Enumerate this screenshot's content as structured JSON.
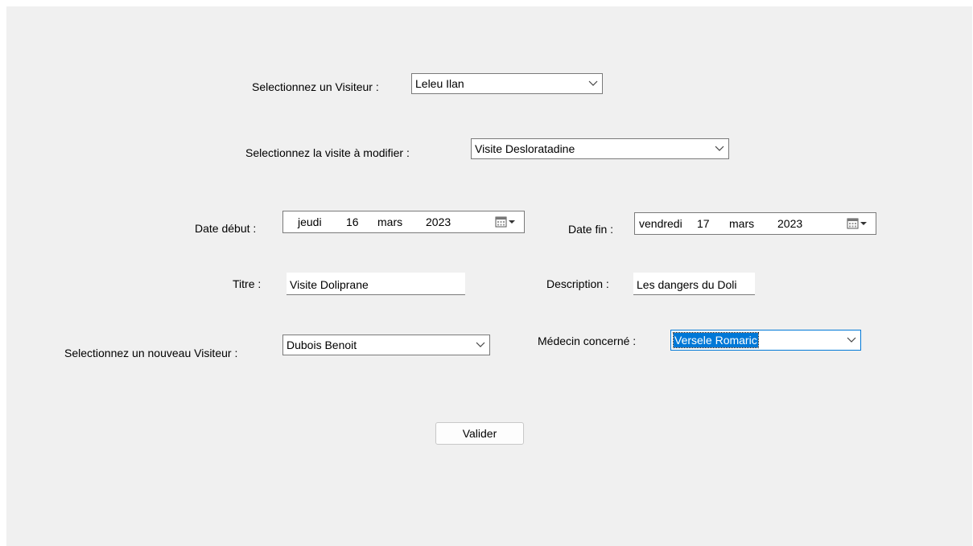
{
  "form": {
    "visiteur_label": "Selectionnez un Visiteur :",
    "visiteur_value": "Leleu Ilan",
    "visite_label": "Selectionnez la visite à modifier :",
    "visite_value": "Visite Desloratadine",
    "date_debut_label": "Date début :",
    "date_debut": {
      "weekday": "jeudi",
      "day": "16",
      "month": "mars",
      "year": "2023"
    },
    "date_fin_label": "Date fin :",
    "date_fin": {
      "weekday": "vendredi",
      "day": "17",
      "month": "mars",
      "year": "2023"
    },
    "titre_label": "Titre :",
    "titre_value": "Visite Doliprane",
    "description_label": "Description :",
    "description_value": "Les dangers du Doli",
    "nouveau_visiteur_label": "Selectionnez un nouveau Visiteur :",
    "nouveau_visiteur_value": "Dubois Benoit",
    "medecin_label": "Médecin concerné :",
    "medecin_value": "Versele Romaric",
    "valider_label": "Valider"
  },
  "icons": {
    "dropdown": "chevron-down-icon",
    "calendar": "calendar-icon"
  },
  "colors": {
    "background": "#f0f0f0",
    "selection": "#0078d7"
  }
}
